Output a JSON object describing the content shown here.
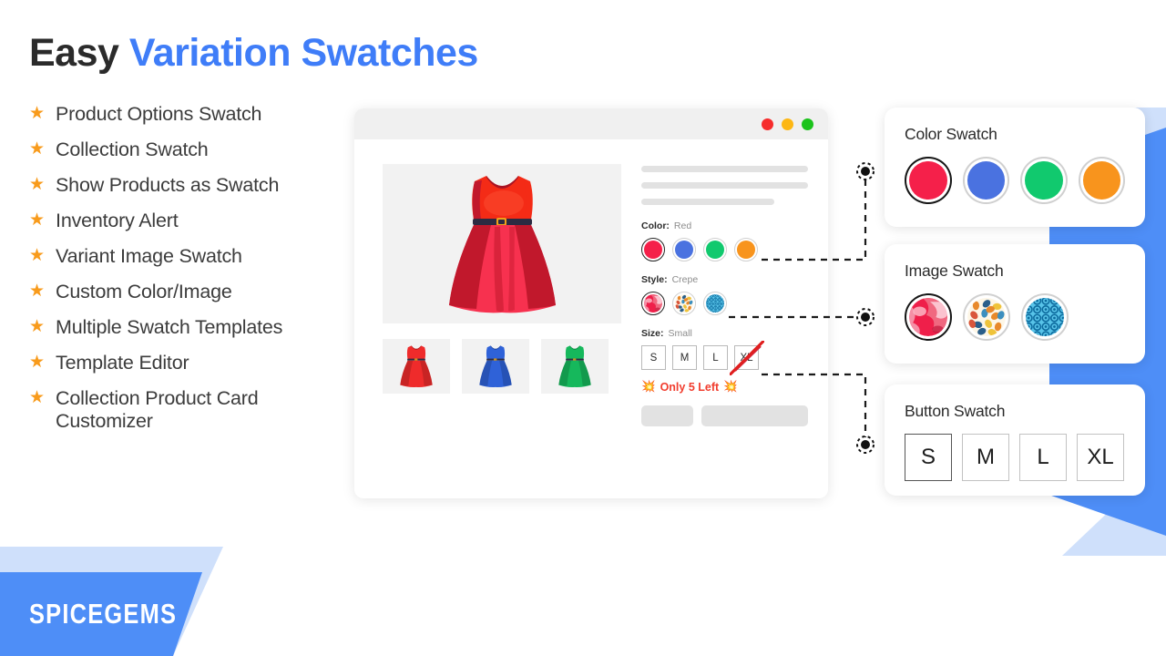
{
  "headline": {
    "part1": "Easy",
    "part2": "Variation Swatches"
  },
  "brand": {
    "name": "SPICEGEMS"
  },
  "features": [
    {
      "label": "Product Options Swatch",
      "icon": "star-icon"
    },
    {
      "label": "Collection Swatch",
      "icon": "star-icon"
    },
    {
      "label": "Show Products as Swatch",
      "icon": "star-icon"
    },
    {
      "label": "Inventory Alert",
      "icon": "star-icon"
    },
    {
      "label": "Variant Image Swatch",
      "icon": "star-icon"
    },
    {
      "label": "Custom Color/Image",
      "icon": "star-icon"
    },
    {
      "label": "Multiple Swatch Templates",
      "icon": "star-icon"
    },
    {
      "label": "Template Editor",
      "icon": "star-icon"
    },
    {
      "label": "Collection Product Card Customizer",
      "icon": "star-icon"
    }
  ],
  "browser": {
    "traffic_lights": [
      {
        "name": "close",
        "color": "#f62c2c"
      },
      {
        "name": "minimize",
        "color": "#fdb714"
      },
      {
        "name": "maximize",
        "color": "#1cc31c"
      }
    ],
    "gallery": {
      "main_image_alt": "red-dress",
      "thumbnails": [
        {
          "alt": "red-dress-thumbnail",
          "color": "#ef2b2b"
        },
        {
          "alt": "blue-dress-thumbnail",
          "color": "#2f62d8"
        },
        {
          "alt": "green-dress-thumbnail",
          "color": "#16b85c"
        }
      ]
    },
    "options": {
      "color": {
        "key": "Color:",
        "value": "Red",
        "swatches": [
          {
            "name": "red",
            "color": "#f5204a",
            "selected": true
          },
          {
            "name": "blue",
            "color": "#4a72e0",
            "selected": false
          },
          {
            "name": "green",
            "color": "#11c96e",
            "selected": false
          },
          {
            "name": "orange",
            "color": "#f8941d",
            "selected": false
          }
        ]
      },
      "style": {
        "key": "Style:",
        "value": "Crepe",
        "swatches": [
          {
            "name": "red-marble-pattern",
            "selected": true
          },
          {
            "name": "confetti-leaf-pattern",
            "selected": false
          },
          {
            "name": "blue-circles-pattern",
            "selected": false
          }
        ]
      },
      "size": {
        "key": "Size:",
        "value": "Small",
        "buttons": [
          {
            "label": "S",
            "selected": true,
            "disabled": false
          },
          {
            "label": "M",
            "selected": false,
            "disabled": false
          },
          {
            "label": "L",
            "selected": false,
            "disabled": false
          },
          {
            "label": "XL",
            "selected": false,
            "disabled": true
          }
        ]
      }
    },
    "stock_alert": {
      "icon_left": "💥",
      "text": "Only 5 Left",
      "icon_right": "💥",
      "color": "#f13d2e"
    }
  },
  "side_cards": [
    {
      "title": "Color Swatch",
      "type": "color",
      "items": [
        {
          "name": "red",
          "color": "#f5204a",
          "selected": true
        },
        {
          "name": "blue",
          "color": "#4a72e0",
          "selected": false
        },
        {
          "name": "green",
          "color": "#11c96e",
          "selected": false
        },
        {
          "name": "orange",
          "color": "#f8941d",
          "selected": false
        }
      ]
    },
    {
      "title": "Image Swatch",
      "type": "image",
      "items": [
        {
          "name": "red-marble-pattern",
          "selected": true
        },
        {
          "name": "confetti-leaf-pattern",
          "selected": false
        },
        {
          "name": "blue-circles-pattern",
          "selected": false
        }
      ]
    },
    {
      "title": "Button Swatch",
      "type": "button",
      "items": [
        {
          "label": "S",
          "selected": true
        },
        {
          "label": "M",
          "selected": false
        },
        {
          "label": "L",
          "selected": false
        },
        {
          "label": "XL",
          "selected": false
        }
      ]
    }
  ],
  "colors": {
    "accent_blue": "#3f7df8",
    "banner_blue": "#4e8ef7",
    "banner_light_blue": "#cfe0fb",
    "star_orange": "#f89b1c",
    "headline_dark": "#2b2b2b"
  }
}
